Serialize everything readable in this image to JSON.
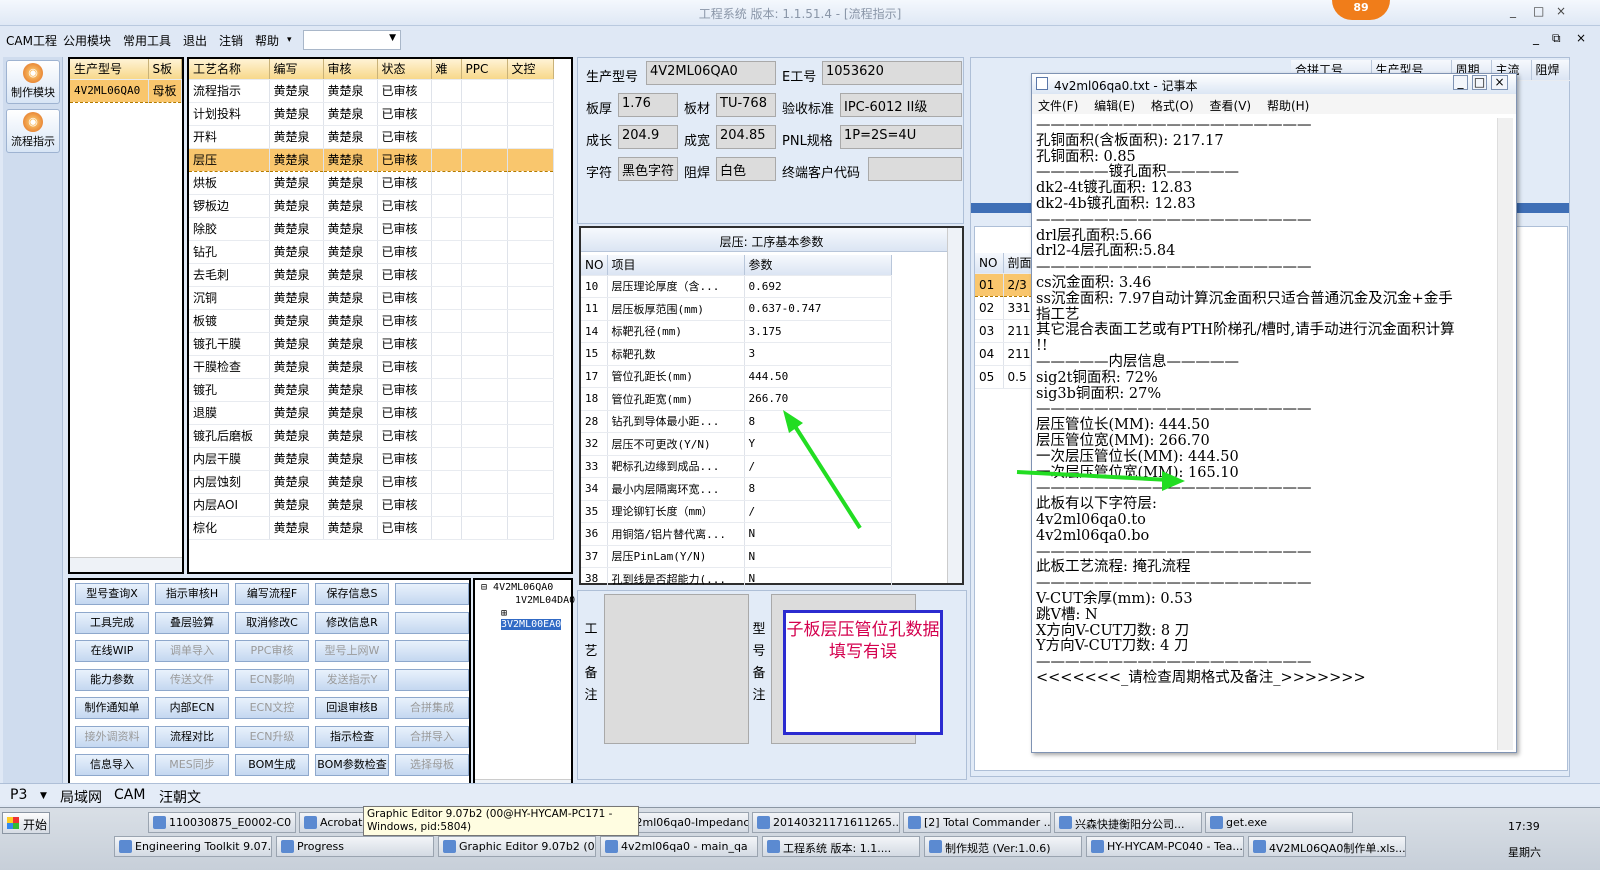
{
  "window": {
    "title": "工程系统  版本: 1.1.51.4 - [流程指示]",
    "badge": "89",
    "min": "_",
    "max": "□",
    "close": "×"
  },
  "menu": [
    "CAM工程",
    "公用模块",
    "常用工具",
    "退出",
    "注销",
    "帮助"
  ],
  "menu_help_arrow": "▾",
  "leftbar": [
    {
      "label": "制作模块"
    },
    {
      "label": "流程指示"
    }
  ],
  "product_list": {
    "headers": [
      "生产型号",
      "S板"
    ],
    "rows": [
      [
        "4V2ML06QA0",
        "母板"
      ]
    ]
  },
  "process_table": {
    "headers": [
      "工艺名称",
      "编写",
      "审核",
      "状态",
      "难",
      "PPC",
      "文控"
    ],
    "rows": [
      [
        "流程指示",
        "黄楚泉",
        "黄楚泉",
        "已审核"
      ],
      [
        "计划投料",
        "黄楚泉",
        "黄楚泉",
        "已审核"
      ],
      [
        "开料",
        "黄楚泉",
        "黄楚泉",
        "已审核"
      ],
      [
        "层压",
        "黄楚泉",
        "黄楚泉",
        "已审核"
      ],
      [
        "烘板",
        "黄楚泉",
        "黄楚泉",
        "已审核"
      ],
      [
        "锣板边",
        "黄楚泉",
        "黄楚泉",
        "已审核"
      ],
      [
        "除胶",
        "黄楚泉",
        "黄楚泉",
        "已审核"
      ],
      [
        "钻孔",
        "黄楚泉",
        "黄楚泉",
        "已审核"
      ],
      [
        "去毛刺",
        "黄楚泉",
        "黄楚泉",
        "已审核"
      ],
      [
        "沉铜",
        "黄楚泉",
        "黄楚泉",
        "已审核"
      ],
      [
        "板镀",
        "黄楚泉",
        "黄楚泉",
        "已审核"
      ],
      [
        "镀孔干膜",
        "黄楚泉",
        "黄楚泉",
        "已审核"
      ],
      [
        "干膜检查",
        "黄楚泉",
        "黄楚泉",
        "已审核"
      ],
      [
        "镀孔",
        "黄楚泉",
        "黄楚泉",
        "已审核"
      ],
      [
        "退膜",
        "黄楚泉",
        "黄楚泉",
        "已审核"
      ],
      [
        "镀孔后磨板",
        "黄楚泉",
        "黄楚泉",
        "已审核"
      ],
      [
        "内层干膜",
        "黄楚泉",
        "黄楚泉",
        "已审核"
      ],
      [
        "内层蚀刻",
        "黄楚泉",
        "黄楚泉",
        "已审核"
      ],
      [
        "内层AOI",
        "黄楚泉",
        "黄楚泉",
        "已审核"
      ],
      [
        "棕化",
        "黄楚泉",
        "黄楚泉",
        "已审核"
      ]
    ],
    "selected_index": 3
  },
  "buttons": [
    [
      "型号查询X",
      "指示审核H",
      "编写流程F",
      "保存信息S",
      ""
    ],
    [
      "工具完成",
      "叠层验算",
      "取消修改C",
      "修改信息R",
      ""
    ],
    [
      "在线WIP",
      "调单导入",
      "PPC审核",
      "型号上网W",
      ""
    ],
    [
      "能力参数",
      "传送文件",
      "ECN影响",
      "发送指示Y",
      ""
    ],
    [
      "制作通知单",
      "内部ECN",
      "ECN文控",
      "回退审核B",
      "合拼集成"
    ],
    [
      "接外调资料",
      "流程对比",
      "ECN升级",
      "指示检查",
      "合拼导入"
    ],
    [
      "信息导入",
      "MES同步",
      "BOM生成",
      "BOM参数检查",
      "选择母板"
    ]
  ],
  "disabled_buttons": [
    "调单导入",
    "PPC审核",
    "型号上网W",
    "传送文件",
    "ECN影响",
    "发送指示Y",
    "接外调资料",
    "ECN文控",
    "ECN升级",
    "合拼集成",
    "合拼导入",
    "MES同步",
    "选择母板"
  ],
  "tree": {
    "root": "4V2ML06QA0",
    "children": [
      "1V2ML04DA0",
      "3V2ML00EA0"
    ]
  },
  "info": {
    "prod_model_label": "生产型号",
    "prod_model": "4V2ML06QA0",
    "e_no_label": "E工号",
    "e_no": "1053620",
    "thick_label": "板厚",
    "thick": "1.76",
    "material_label": "板材",
    "material": "TU-768",
    "std_label": "验收标准",
    "std": "IPC-6012 II级",
    "len_label": "成长",
    "len": "204.9",
    "width_label": "成宽",
    "width": "204.85",
    "pnl_label": "PNL规格",
    "pnl": "1P=2S=4U",
    "char_label": "字符",
    "char": "黑色字符",
    "mask_label": "阻焊",
    "mask": "白色",
    "cust_label": "终端客户代码",
    "cust": ""
  },
  "param_panel": {
    "title": "层压: 工序基本参数",
    "headers": [
      "NO",
      "项目",
      "参数"
    ],
    "rows": [
      [
        "10",
        "层压理论厚度（含...",
        "0.692"
      ],
      [
        "11",
        "层压板厚范围(mm)",
        "0.637-0.747"
      ],
      [
        "14",
        "标靶孔径(mm)",
        "3.175"
      ],
      [
        "15",
        "标靶孔数",
        "3"
      ],
      [
        "17",
        "管位孔距长(mm)",
        "444.50"
      ],
      [
        "18",
        "管位孔距宽(mm)",
        "266.70"
      ],
      [
        "28",
        "钻孔到导体最小距...",
        "8"
      ],
      [
        "32",
        "层压不可更改(Y/N)",
        "Y"
      ],
      [
        "33",
        "靶标孔边缘到成品...",
        "/"
      ],
      [
        "34",
        "最小内层隔离环宽...",
        "8"
      ],
      [
        "35",
        "理论铆钉长度（mm）",
        "/"
      ],
      [
        "36",
        "用铜箔/铝片替代离...",
        "N"
      ],
      [
        "37",
        "层压PinLam(Y/N)",
        "N"
      ],
      [
        "38",
        "孔到线是否超能力(...",
        "N"
      ]
    ]
  },
  "notes": {
    "craft_label": "工艺备注",
    "model_label": "型号备注",
    "annotation": "子板层压管位孔数据填写有误"
  },
  "right_panel": {
    "headers": [
      "NO",
      "剖面"
    ],
    "rows": [
      [
        "01",
        "2/3"
      ],
      [
        "02",
        "331"
      ],
      [
        "03",
        "211"
      ],
      [
        "04",
        "211"
      ],
      [
        "05",
        "0.5"
      ]
    ],
    "top_headers": [
      "合拼工号",
      "生产型号",
      "周期",
      "主流",
      "阻焊"
    ]
  },
  "notepad": {
    "title": "4v2ml06qa0.txt - 记事本",
    "menu": [
      "文件(F)",
      "编辑(E)",
      "格式(O)",
      "查看(V)",
      "帮助(H)"
    ],
    "lines": [
      "———————————————————",
      "孔铜面积(含板面积): 217.17",
      "孔铜面积: 0.85",
      "—————镀孔面积—————",
      "dk2-4t镀孔面积: 12.83",
      "dk2-4b镀孔面积: 12.83",
      "",
      "———————————————————",
      "drl层孔面积:5.66",
      "drl2-4层孔面积:5.84",
      "",
      "———————————————————",
      "cs沉金面积: 3.46",
      "ss沉金面积: 7.97自动计算沉金面积只适合普通沉金及沉金+金手",
      "指工艺",
      "其它混合表面工艺或有PTH阶梯孔/槽时,请手动进行沉金面积计算",
      "!!",
      "—————内层信息—————",
      "sig2t铜面积: 72%",
      "sig3b铜面积: 27%",
      "———————————————————",
      "层压管位长(MM): 444.50",
      "层压管位宽(MM): 266.70",
      "一次层压管位长(MM): 444.50",
      "一次层压管位宽(MM): 165.10",
      "———————————————————",
      "此板有以下字符层:",
      "4v2ml06qa0.to",
      "4v2ml06qa0.bo",
      "———————————————————",
      "此板工艺流程: 掩孔流程",
      "———————————————————",
      "V-CUT余厚(mm): 0.53",
      "跳V槽: N",
      "X方向V-CUT刀数: 8 刀",
      "Y方向V-CUT刀数: 4 刀",
      "———————————————————",
      "<<<<<<<_请检查周期格式及备注_>>>>>>>"
    ]
  },
  "statusbar": [
    "P3",
    "局域网",
    "CAM",
    "汪朝文"
  ],
  "tooltip": "Graphic Editor 9.07b2 (00@HY-HYCAM-PC171 - Windows, pid:5804)",
  "taskbar": {
    "start": "开始",
    "row1": [
      "110030875_E0002-C0 ...",
      "Acrobat X",
      "计算器",
      "4v2ml06qa0-Impedanc...",
      "20140321171611265....",
      "[2] Total Commander ...",
      "兴森快捷衡阳分公司...",
      "get.exe"
    ],
    "row2": [
      "Engineering Toolkit 9.07...",
      "Progress",
      "Graphic Editor 9.07b2 (0...",
      "4v2ml06qa0 - main_qa",
      "工程系统  版本: 1.1....",
      "制作规范 (Ver:1.0.6)",
      "HY-HYCAM-PC040 - Tea...",
      "4V2ML06QA0制作单.xls..."
    ],
    "time": "17:39",
    "day": "星期六"
  },
  "colors": {
    "arrow": "#22dd22",
    "accent": "#f9c66d",
    "annotation_border": "#2b2bd0",
    "annotation_text": "#d4004e"
  }
}
